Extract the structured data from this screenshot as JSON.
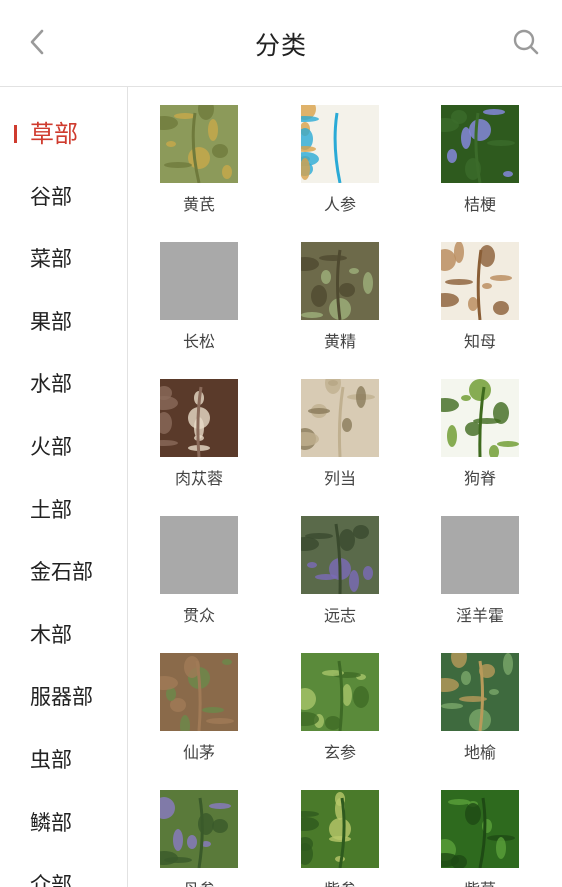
{
  "header": {
    "title": "分类"
  },
  "sidebar": {
    "items": [
      {
        "label": "草部",
        "active": true
      },
      {
        "label": "谷部"
      },
      {
        "label": "菜部"
      },
      {
        "label": "果部"
      },
      {
        "label": "水部"
      },
      {
        "label": "火部"
      },
      {
        "label": "土部"
      },
      {
        "label": "金石部"
      },
      {
        "label": "木部"
      },
      {
        "label": "服器部"
      },
      {
        "label": "虫部"
      },
      {
        "label": "鳞部"
      },
      {
        "label": "介部"
      }
    ]
  },
  "herbs": [
    {
      "name": "黄芪",
      "image": "plant-photo",
      "colors": [
        "#8c9a5a",
        "#c8a94a",
        "#6f7a3c"
      ]
    },
    {
      "name": "人参",
      "image": "root-photo",
      "colors": [
        "#f4f2ea",
        "#d9a14a",
        "#2aaad6"
      ]
    },
    {
      "name": "桔梗",
      "image": "flower-photo",
      "colors": [
        "#2e5a1e",
        "#8a8ae6",
        "#3b6b2a"
      ]
    },
    {
      "name": "长松",
      "image": "placeholder",
      "colors": [
        "#a9a9a9"
      ]
    },
    {
      "name": "黄精",
      "image": "plant-photo",
      "colors": [
        "#6d6a4a",
        "#9db07a",
        "#4f4a30"
      ]
    },
    {
      "name": "知母",
      "image": "root-photo",
      "colors": [
        "#f2ece0",
        "#b88a5a",
        "#8a5e36"
      ]
    },
    {
      "name": "肉苁蓉",
      "image": "plant-photo",
      "colors": [
        "#5a3a2a",
        "#e8dcc8",
        "#8a6a5a"
      ]
    },
    {
      "name": "列当",
      "image": "plant-photo",
      "colors": [
        "#d8cbb4",
        "#8a7a5a",
        "#c0b090"
      ]
    },
    {
      "name": "狗脊",
      "image": "fern-photo",
      "colors": [
        "#f4f6ee",
        "#6a9a2a",
        "#3e6a1e"
      ]
    },
    {
      "name": "贯众",
      "image": "placeholder",
      "colors": [
        "#a9a9a9"
      ]
    },
    {
      "name": "远志",
      "image": "flower-photo",
      "colors": [
        "#5a6a4a",
        "#7a6ab8",
        "#3a4a2e"
      ]
    },
    {
      "name": "淫羊霍",
      "image": "placeholder",
      "colors": [
        "#a9a9a9"
      ]
    },
    {
      "name": "仙茅",
      "image": "plant-photo",
      "colors": [
        "#8a6a4a",
        "#6a8a4a",
        "#a07a56"
      ]
    },
    {
      "name": "玄参",
      "image": "plant-photo",
      "colors": [
        "#5a8a3a",
        "#a8c46a",
        "#3e6a26"
      ]
    },
    {
      "name": "地榆",
      "image": "plant-photo",
      "colors": [
        "#3e6a3e",
        "#7aa86a",
        "#b89a5a"
      ]
    },
    {
      "name": "丹参",
      "image": "flower-photo",
      "colors": [
        "#5a7a3a",
        "#8a7ac4",
        "#3a5a2a"
      ]
    },
    {
      "name": "紫参",
      "image": "plant-photo",
      "colors": [
        "#4a7a2a",
        "#b8c86a",
        "#2e5a1e"
      ]
    },
    {
      "name": "紫草",
      "image": "plant-photo",
      "colors": [
        "#2e6a1e",
        "#5aa03a",
        "#1e4a14"
      ]
    }
  ],
  "icons": {
    "back": "chevron-left-icon",
    "search": "search-icon"
  },
  "colors": {
    "accent": "#cf3b2e",
    "placeholder": "#a9a9a9",
    "divider": "#e2e2e2"
  }
}
